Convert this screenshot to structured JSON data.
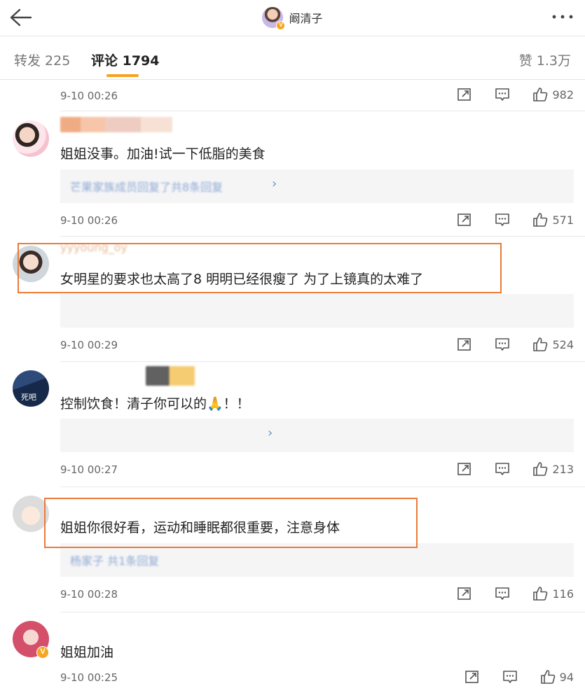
{
  "header": {
    "username": "阚清子",
    "back_icon": "back-arrow-icon",
    "more_icon": "more-dots-icon",
    "verified_badge": "V"
  },
  "tabs": {
    "repost": "转发 225",
    "comment": "评论 1794",
    "like": "赞 1.3万",
    "accent_color": "#f6a21d"
  },
  "comments": [
    {
      "time": "9-10 00:26",
      "likes": "982"
    },
    {
      "text": "姐姐没事。加油!试一下低脂的美食",
      "sub_link": "芒果家族成员回复了共8条回复",
      "time": "9-10 00:26",
      "likes": "571"
    },
    {
      "username": "yyyoung_oy",
      "text": "女明星的要求也太高了8 明明已经很瘦了 为了上镜真的太难了",
      "time": "9-10 00:29",
      "likes": "524"
    },
    {
      "avatar_label": "死吧",
      "text": "控制饮食！清子你可以的🙏！！",
      "time": "9-10 00:27",
      "likes": "213"
    },
    {
      "text": "姐姐你很好看，运动和睡眠都很重要，注意身体",
      "sub_link": "杨家子 共1条回复",
      "time": "9-10 00:28",
      "likes": "116"
    },
    {
      "text": "姐姐加油",
      "time": "9-10 00:25",
      "likes": "94"
    }
  ],
  "colors": {
    "highlight": "#ec7a38",
    "link": "#6a8ec8"
  }
}
